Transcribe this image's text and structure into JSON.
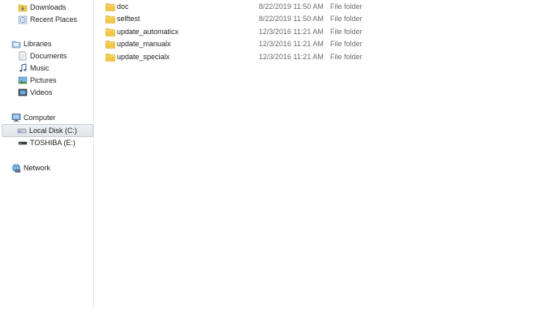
{
  "nav": {
    "favorites": [
      {
        "label": "Downloads",
        "icon": "downloads-folder-icon"
      },
      {
        "label": "Recent Places",
        "icon": "recent-places-icon"
      }
    ],
    "libraries": {
      "label": "Libraries",
      "icon": "libraries-icon",
      "items": [
        {
          "label": "Documents",
          "icon": "documents-icon"
        },
        {
          "label": "Music",
          "icon": "music-icon"
        },
        {
          "label": "Pictures",
          "icon": "pictures-icon"
        },
        {
          "label": "Videos",
          "icon": "videos-icon"
        }
      ]
    },
    "computer": {
      "label": "Computer",
      "icon": "computer-icon",
      "items": [
        {
          "label": "Local Disk (C:)",
          "icon": "local-disk-icon",
          "selected": true
        },
        {
          "label": "TOSHIBA (E:)",
          "icon": "removable-drive-icon",
          "selected": false
        }
      ]
    },
    "network": {
      "label": "Network",
      "icon": "network-icon"
    }
  },
  "files": [
    {
      "name": "doc",
      "date": "8/22/2019 11:50 AM",
      "type": "File folder"
    },
    {
      "name": "selftest",
      "date": "8/22/2019 11:50 AM",
      "type": "File folder"
    },
    {
      "name": "update_automaticx",
      "date": "12/3/2016 11:21 AM",
      "type": "File folder"
    },
    {
      "name": "update_manualx",
      "date": "12/3/2016 11:21 AM",
      "type": "File folder"
    },
    {
      "name": "update_specialx",
      "date": "12/3/2016 11:21 AM",
      "type": "File folder"
    }
  ],
  "colors": {
    "folder": "#f3c845",
    "folder_dark": "#d9a521",
    "selection": "#e2e5ea",
    "secondary_text": "#6d6d6d",
    "pane_border": "#e3e8ee"
  }
}
